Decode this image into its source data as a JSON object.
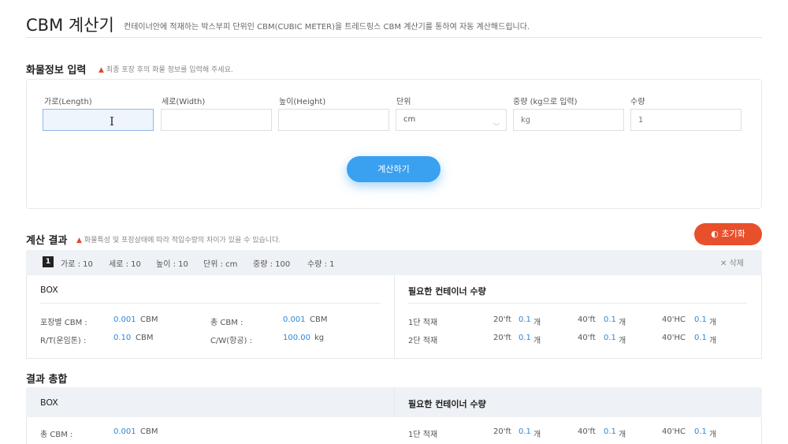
{
  "page": {
    "title": "CBM 계산기",
    "description": "컨테이너안에 적재하는 박스부피 단위인 CBM(CUBIC METER)을 트레드링스 CBM 계산기를 통하여 자동 계산해드립니다."
  },
  "input_section": {
    "title": "화물정보 입력",
    "notice": "최종 포장 후의 화물 정보를 입력해 주세요.",
    "fields": {
      "length": {
        "label": "가로(Length)",
        "value": ""
      },
      "width": {
        "label": "세로(Width)",
        "value": ""
      },
      "height": {
        "label": "높이(Height)",
        "value": ""
      },
      "unit": {
        "label": "단위",
        "value": "cm"
      },
      "weight": {
        "label": "중량 (kg으로 입력)",
        "placeholder": "kg"
      },
      "qty": {
        "label": "수량",
        "placeholder": "1"
      }
    },
    "calc_button": "계산하기"
  },
  "result_section": {
    "title": "계산 결과",
    "notice": "화물특성 및 포장상태에 따라 적입수량의 차이가 있을 수 있습니다.",
    "reset_button": "초기화",
    "item": {
      "index": "1",
      "summary": [
        "가로 : 10",
        "세로 : 10",
        "높이 : 10",
        "단위 : cm",
        "중량 : 100",
        "수량 : 1"
      ],
      "delete_label": "삭제",
      "box_title": "BOX",
      "cbm_each_label": "포장별 CBM :",
      "cbm_each_value": "0.001",
      "cbm_each_unit": "CBM",
      "cbm_total_label": "총 CBM :",
      "cbm_total_value": "0.001",
      "cbm_total_unit": "CBM",
      "rt_label": "R/T(운임톤) :",
      "rt_value": "0.10",
      "rt_unit": "CBM",
      "cw_label": "C/W(항공) :",
      "cw_value": "100.00",
      "cw_unit": "kg",
      "container_title": "필요한 컨테이너 수량",
      "rows": [
        {
          "label": "1단 적재",
          "ft20": "20'ft",
          "v20": "0.1",
          "ft40": "40'ft",
          "v40": "0.1",
          "hc": "40'HC",
          "vhc": "0.1",
          "unit": "개"
        },
        {
          "label": "2단 적재",
          "ft20": "20'ft",
          "v20": "0.1",
          "ft40": "40'ft",
          "v40": "0.1",
          "hc": "40'HC",
          "vhc": "0.1",
          "unit": "개"
        }
      ]
    }
  },
  "summary_section": {
    "title": "결과 총합",
    "box_title": "BOX",
    "container_title": "필요한 컨테이너 수량",
    "cbm_total_label": "총 CBM :",
    "cbm_total_value": "0.001",
    "cbm_total_unit": "CBM",
    "row": {
      "label": "1단 적재",
      "ft20": "20'ft",
      "v20": "0.1",
      "ft40": "40'ft",
      "v40": "0.1",
      "hc": "40'HC",
      "vhc": "0.1",
      "unit": "개"
    }
  },
  "icons": {
    "warning": "warning-icon",
    "reset": "reset-icon",
    "close": "close-icon",
    "chevron": "chevron-down-icon",
    "cursor": "text-cursor-icon"
  },
  "colors": {
    "accent_blue": "#3aa0f0",
    "value_blue": "#2f86d8",
    "reset_red": "#e8502c",
    "warning_red": "#e04a2a"
  }
}
